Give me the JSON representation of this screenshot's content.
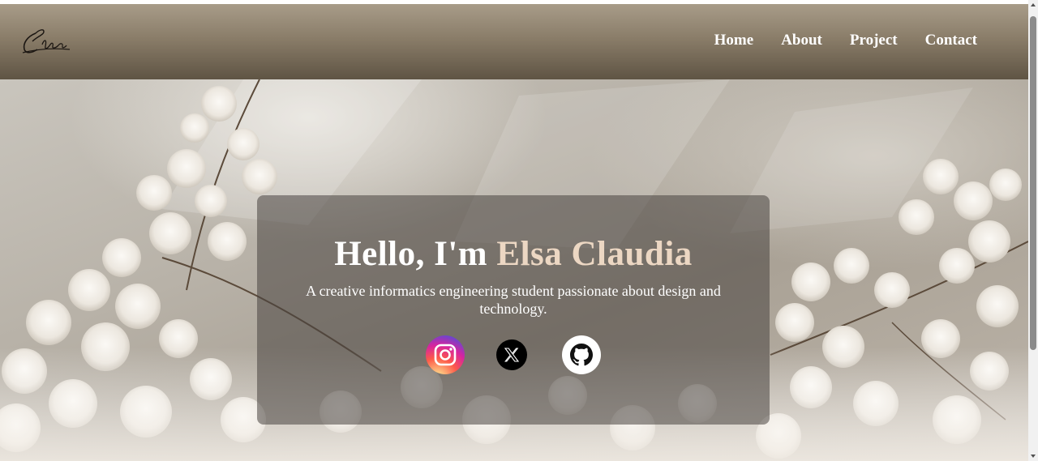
{
  "navbar": {
    "logo_text": "Elsa",
    "links": [
      {
        "label": "Home"
      },
      {
        "label": "About"
      },
      {
        "label": "Project"
      },
      {
        "label": "Contact"
      }
    ]
  },
  "hero": {
    "title_prefix": "Hello, I'm ",
    "title_name": "Elsa Claudia",
    "subtitle": "A creative informatics engineering student passionate about design and technology.",
    "socials": [
      {
        "icon": "instagram-icon"
      },
      {
        "icon": "x-icon"
      },
      {
        "icon": "github-icon"
      }
    ]
  },
  "colors": {
    "accent": "#ecd7c3",
    "nav_top": "#a89c89",
    "nav_bottom": "#5f5444"
  }
}
